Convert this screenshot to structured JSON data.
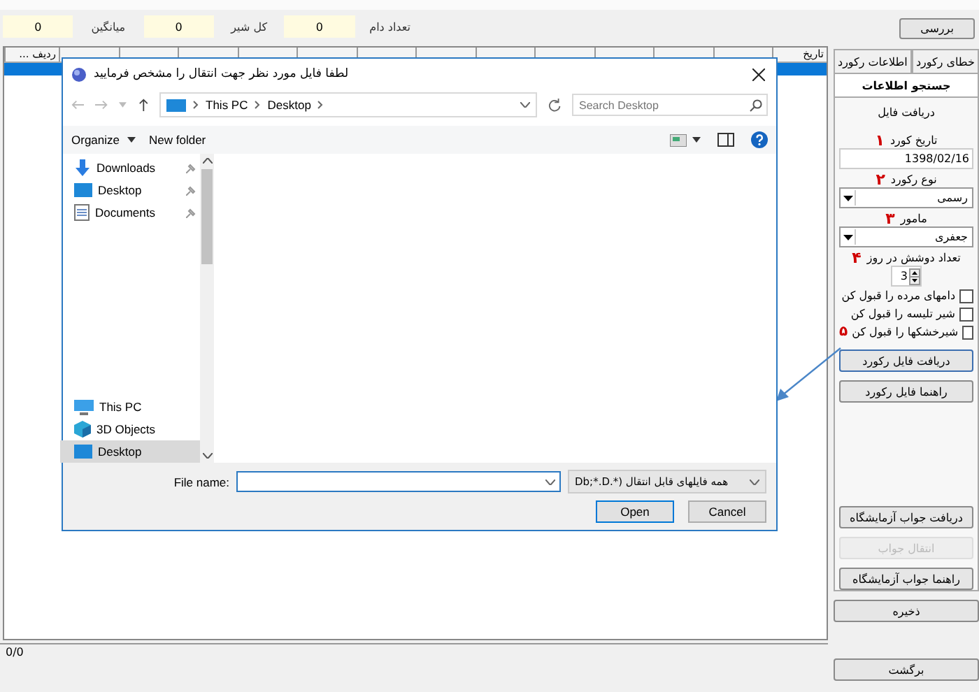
{
  "stats": [
    {
      "label": "تعداد دام",
      "value": "0"
    },
    {
      "label": "کل شیر",
      "value": "0"
    },
    {
      "label": "میانگین",
      "value": "0"
    }
  ],
  "grid": {
    "columns": [
      {
        "label": "تاریخ"
      },
      {
        "label": "ردیف ..."
      }
    ],
    "rows": [
      {
        "selected": true
      }
    ]
  },
  "status_bar": "0/0",
  "check_button": "بررسی",
  "tabs": [
    {
      "label": "خطای رکورد",
      "selected": false
    },
    {
      "label": "اطلاعات رکورد",
      "selected": false
    },
    {
      "label": "جستجو اطلاعات",
      "selected": true
    }
  ],
  "panel": {
    "title": "دریافت فایل",
    "fields": [
      {
        "kind": "text",
        "label": "تاریخ کورد",
        "value": "1398/02/16",
        "marker": "۱"
      },
      {
        "kind": "combo",
        "label": "نوع رکورد",
        "value": "رسمی",
        "marker": "۲"
      },
      {
        "kind": "combo",
        "label": "مامور",
        "value": "جعفری",
        "marker": "۳"
      },
      {
        "kind": "spin",
        "label": "تعداد دوشش در روز",
        "value": "3",
        "marker": "۴"
      }
    ],
    "checkboxes": [
      {
        "label": "دامهای مرده را قبول کن",
        "checked": false
      },
      {
        "label": "شیر تلیسه را قبول کن",
        "checked": false
      },
      {
        "label": "شیرخشکها را قبول کن",
        "checked": false,
        "marker": "۵"
      }
    ],
    "buttons": [
      {
        "label": "دریافت فایل رکورد",
        "focused": true
      },
      {
        "label": "راهنما فایل رکورد",
        "focused": false
      }
    ],
    "lab_buttons": [
      {
        "label": "دریافت جواب آزمایشگاه",
        "disabled": false
      },
      {
        "label": "انتقال جواب",
        "disabled": true
      },
      {
        "label": "راهنما جواب آزمایشگاه",
        "disabled": false
      }
    ]
  },
  "save_button": "ذخیره",
  "back_button": "برگشت",
  "dialog": {
    "title": "لطفا فایل مورد نظر جهت انتقال را مشخص فرمایید",
    "path": {
      "computer": "This PC",
      "folder": "Desktop"
    },
    "search": {
      "placeholder": "Search Desktop"
    },
    "toolbar": {
      "organize": "Organize",
      "new_folder": "New folder"
    },
    "nav_groups": [
      [
        {
          "label": "Downloads",
          "kind": "download",
          "pinned": true,
          "selected": false
        },
        {
          "label": "Desktop",
          "kind": "desktop",
          "pinned": true,
          "selected": false
        },
        {
          "label": "Documents",
          "kind": "documents",
          "pinned": true,
          "selected": false
        }
      ],
      [
        {
          "label": "This PC",
          "kind": "pc",
          "pinned": false,
          "selected": false
        },
        {
          "label": "3D Objects",
          "kind": "cube",
          "pinned": false,
          "selected": false
        },
        {
          "label": "Desktop",
          "kind": "desktop",
          "pinned": false,
          "selected": true
        }
      ]
    ],
    "file_name_label": "File name:",
    "filter": "همه فایلهای قابل انتقال (*.Db;*.D",
    "open_button": "Open",
    "cancel_button": "Cancel"
  }
}
